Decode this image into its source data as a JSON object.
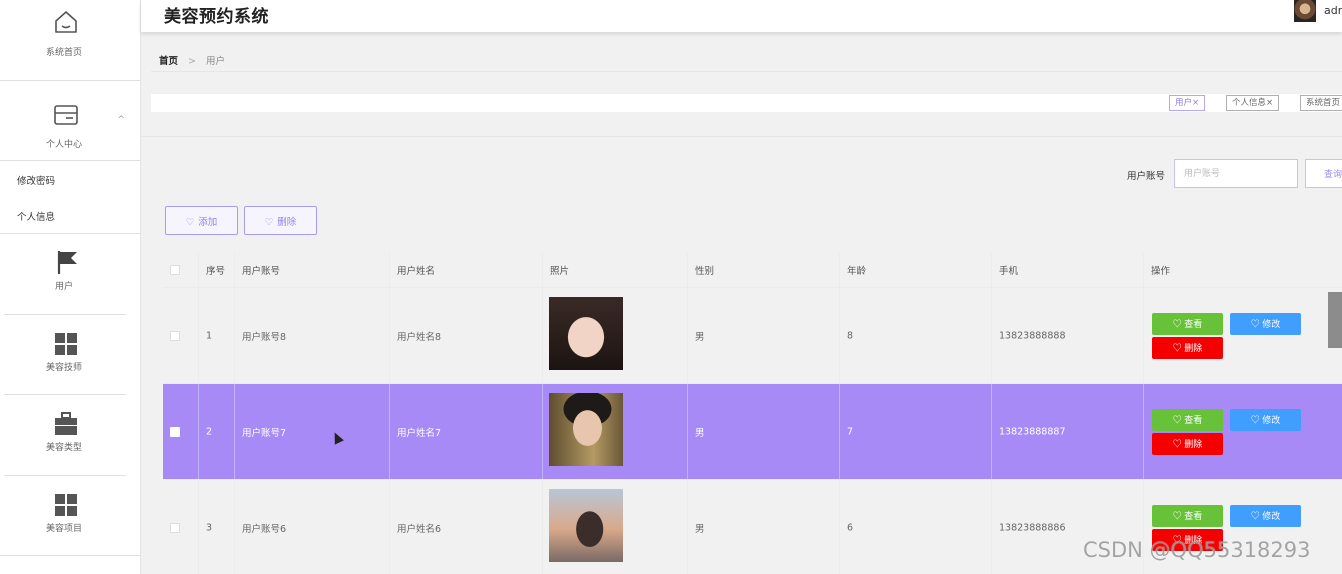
{
  "app": {
    "title": "美容预约系统",
    "user_name": "adm"
  },
  "sidebar": {
    "home_label": "系统首页",
    "personal": {
      "label": "个人中心",
      "sub_items": [
        "修改密码",
        "个人信息"
      ]
    },
    "items": [
      {
        "label": "用户",
        "icon": "flag-icon"
      },
      {
        "label": "美容技师",
        "icon": "grid-icon"
      },
      {
        "label": "美容类型",
        "icon": "briefcase-icon"
      },
      {
        "label": "美容项目",
        "icon": "grid-icon"
      }
    ]
  },
  "breadcrumb": {
    "home": "首页",
    "separator": ">",
    "current": "用户"
  },
  "tags": [
    "用户×",
    "个人信息×",
    "系统首页"
  ],
  "search": {
    "label": "用户账号",
    "placeholder": "用户账号",
    "button_label": "查询"
  },
  "toolbar": {
    "add_label": "添加",
    "delete_label": "删除"
  },
  "table": {
    "columns": [
      "序号",
      "用户账号",
      "用户姓名",
      "照片",
      "性别",
      "年龄",
      "手机",
      "操作"
    ],
    "rows": [
      {
        "index": "1",
        "account": "用户账号8",
        "name": "用户姓名8",
        "gender": "男",
        "age": "8",
        "phone": "13823888888",
        "selected": false
      },
      {
        "index": "2",
        "account": "用户账号7",
        "name": "用户姓名7",
        "gender": "男",
        "age": "7",
        "phone": "13823888887",
        "selected": true
      },
      {
        "index": "3",
        "account": "用户账号6",
        "name": "用户姓名6",
        "gender": "男",
        "age": "6",
        "phone": "13823888886",
        "selected": false
      }
    ],
    "actions": {
      "view": "查看",
      "edit": "修改",
      "delete": "删除"
    }
  },
  "watermark": "CSDN @QQ55318293",
  "colors": {
    "accent": "#a88af6",
    "view": "#67c23a",
    "edit": "#409eff",
    "delete": "#f50000"
  }
}
